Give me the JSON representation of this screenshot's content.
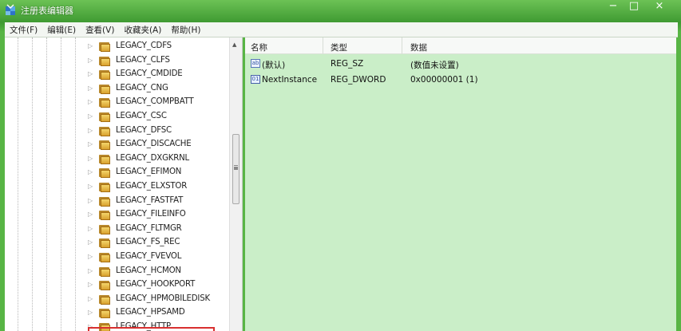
{
  "window": {
    "title": "注册表编辑器",
    "minimize": "−",
    "maximize": "□",
    "close": "×"
  },
  "menu": [
    "文件(F)",
    "编辑(E)",
    "查看(V)",
    "收藏夹(A)",
    "帮助(H)"
  ],
  "tree": [
    "LEGACY_CDFS",
    "LEGACY_CLFS",
    "LEGACY_CMDIDE",
    "LEGACY_CNG",
    "LEGACY_COMPBATT",
    "LEGACY_CSC",
    "LEGACY_DFSC",
    "LEGACY_DISCACHE",
    "LEGACY_DXGKRNL",
    "LEGACY_EFIMON",
    "LEGACY_ELXSTOR",
    "LEGACY_FASTFAT",
    "LEGACY_FILEINFO",
    "LEGACY_FLTMGR",
    "LEGACY_FS_REC",
    "LEGACY_FVEVOL",
    "LEGACY_HCMON",
    "LEGACY_HOOKPORT",
    "LEGACY_HPMOBILEDISK",
    "LEGACY_HPSAMD",
    "LEGACY_HTTP"
  ],
  "list": {
    "columns": {
      "name": "名称",
      "type": "类型",
      "data": "数据"
    },
    "rows": [
      {
        "icon": "string-value-icon",
        "name": "(默认)",
        "type": "REG_SZ",
        "data": "(数值未设置)"
      },
      {
        "icon": "binary-value-icon",
        "name": "NextInstance",
        "type": "REG_DWORD",
        "data": "0x00000001 (1)"
      }
    ]
  }
}
